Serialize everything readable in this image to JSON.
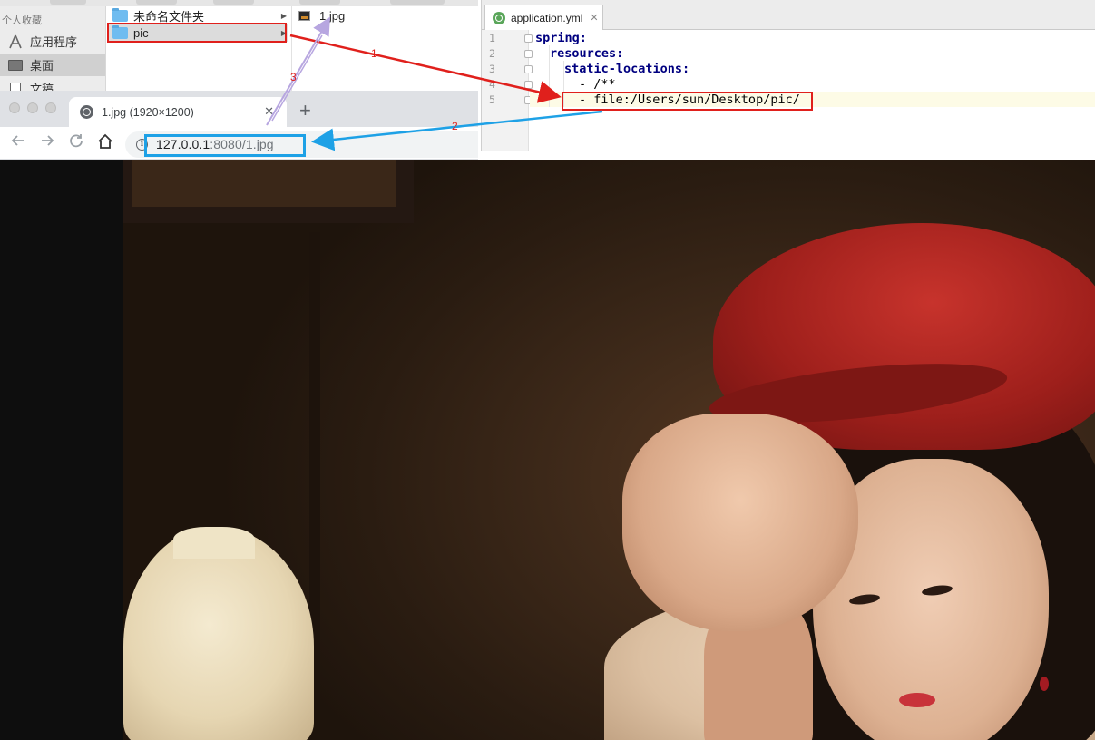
{
  "finder": {
    "sidebar": {
      "section_label": "个人收藏",
      "items": [
        {
          "label": "应用程序",
          "icon": "apps-icon"
        },
        {
          "label": "桌面",
          "icon": "desktop-icon",
          "selected": true
        },
        {
          "label": "文稿",
          "icon": "documents-icon"
        }
      ]
    },
    "column1": [
      {
        "label": "未命名文件夹",
        "icon": "folder-icon"
      },
      {
        "label": "pic",
        "icon": "folder-icon",
        "selected": true
      }
    ],
    "column2": [
      {
        "label": "1.jpg",
        "icon": "jpg-file-icon"
      }
    ]
  },
  "ide": {
    "tab_label": "application.yml",
    "line_numbers": [
      "1",
      "2",
      "3",
      "4",
      "5"
    ],
    "code": {
      "line1_key": "spring:",
      "line2_key": "resources:",
      "line3_key": "static-locations:",
      "line4": "- /**",
      "line5": "- file:/Users/sun/Desktop/pic/"
    }
  },
  "browser": {
    "tab_title": "1.jpg (1920×1200)",
    "new_tab_label": "+",
    "url_host": "127.0.0.1",
    "url_rest": ":8080/1.jpg"
  },
  "annotations": {
    "step1": "1",
    "step2": "2",
    "step3": "3",
    "colors": {
      "step1": "#e0201c",
      "step2": "#1ea1e6",
      "step3": "#b7a6e0"
    }
  }
}
